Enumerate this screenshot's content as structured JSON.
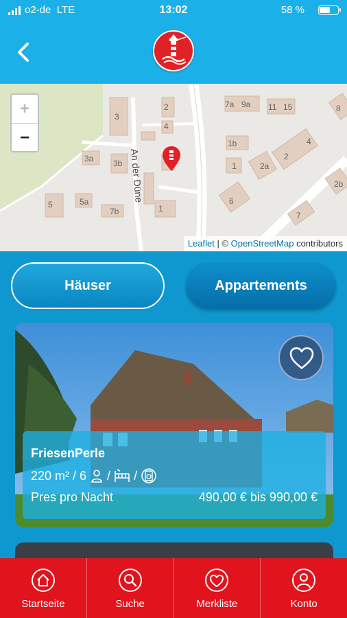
{
  "status_bar": {
    "carrier": "o2-de",
    "network": "LTE",
    "time": "13:02",
    "battery": "58 %",
    "battery_level": 0.58
  },
  "nav": {
    "back_icon": "chevron-left-icon",
    "logo_icon": "lighthouse-logo"
  },
  "map": {
    "zoom_in": "+",
    "zoom_out": "−",
    "street_label": "An der Düne",
    "house_numbers": [
      "3",
      "3a",
      "3b",
      "5",
      "5a",
      "7b",
      "1",
      "2",
      "4",
      "6",
      "7a",
      "9a",
      "11",
      "15",
      "1b",
      "1",
      "2a",
      "2",
      "4",
      "6",
      "2b",
      "7",
      "8"
    ],
    "attribution": {
      "leaflet": "Leaflet",
      "separator": " | © ",
      "osm": "OpenStreetMap",
      "suffix": " contributors"
    }
  },
  "tabs": [
    {
      "label": "Häuser",
      "active": true
    },
    {
      "label": "Appartements",
      "active": false
    }
  ],
  "listing": {
    "name": "FriesenPerle",
    "area": "220 m²",
    "guests": "/ 6",
    "price_label": "Pres pro Nacht",
    "price": "490,00 € bis 990,00 €",
    "favorite_icon": "heart-icon"
  },
  "tab_bar": [
    {
      "label": "Startseite",
      "icon": "home-icon"
    },
    {
      "label": "Suche",
      "icon": "search-icon"
    },
    {
      "label": "Merkliste",
      "icon": "heart-icon"
    },
    {
      "label": "Konto",
      "icon": "user-icon"
    }
  ],
  "colors": {
    "header": "#1cb0e8",
    "background": "#0f98cf",
    "tab_bar": "#e1141d",
    "overlay": "#1cb0e2"
  }
}
